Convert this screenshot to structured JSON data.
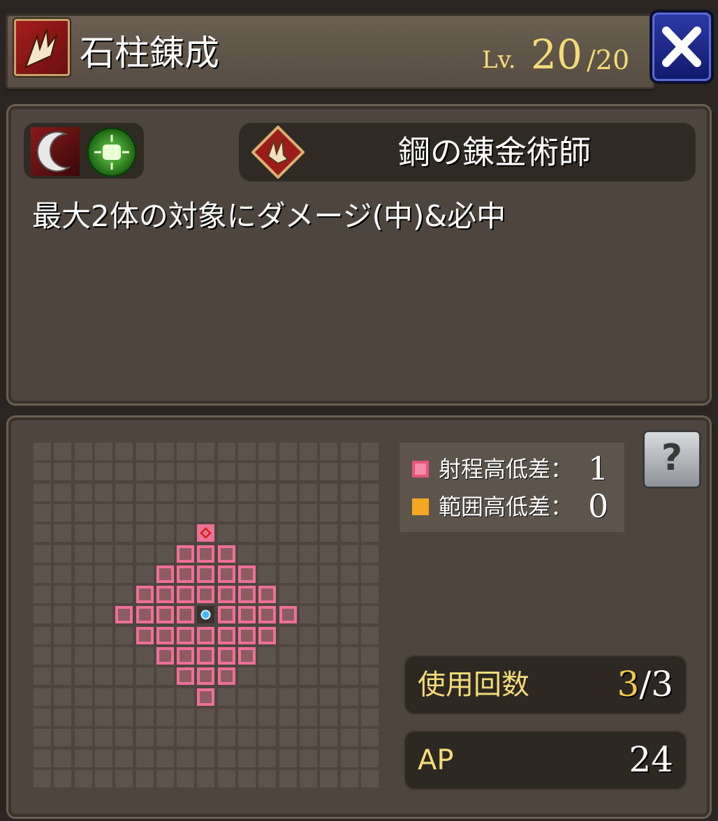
{
  "header": {
    "title": "石柱錬成",
    "level_prefix": "Lv.",
    "level_current": "20",
    "level_max": "/20"
  },
  "skill": {
    "class_name": "鋼の錬金術師",
    "description": "最大2体の対象にダメージ(中)&必中",
    "element_icons": [
      "crescent-slash-icon",
      "green-fist-icon"
    ],
    "class_icon": "skeleton-hand-diamond-icon"
  },
  "legend": {
    "range_height_label": "射程高低差：",
    "range_height_value": "1",
    "area_height_label": "範囲高低差：",
    "area_height_value": "0"
  },
  "stats": {
    "uses_label": "使用回数",
    "uses_current": "3",
    "uses_max": "/3",
    "ap_label": "AP",
    "ap_value": "24"
  },
  "colors": {
    "level_gold": "#f3dc78",
    "range_pink": "#ef6f98",
    "area_orange": "#f5a623",
    "close_blue": "#2d3aa8"
  }
}
